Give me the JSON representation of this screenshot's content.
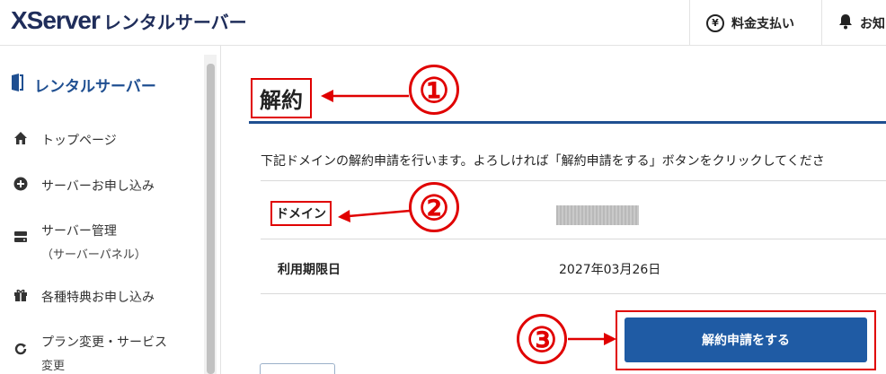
{
  "header": {
    "brand": "XServer",
    "product": "レンタルサーバー",
    "payment_label": "料金支払い",
    "notice_label": "お知"
  },
  "sidebar": {
    "title": "レンタルサーバー",
    "items": [
      {
        "label": "トップページ",
        "icon": "home-icon"
      },
      {
        "label": "サーバーお申し込み",
        "icon": "plus-circle-icon"
      },
      {
        "label": "サーバー管理",
        "sub": "（サーバーパネル）",
        "icon": "server-icon"
      },
      {
        "label": "各種特典お申し込み",
        "icon": "gift-icon"
      },
      {
        "label": "プラン変更・サービス",
        "sub": "変更",
        "icon": "refresh-icon"
      }
    ]
  },
  "main": {
    "title": "解約",
    "description": "下記ドメインの解約申請を行います。よろしければ「解約申請をする」ボタンをクリックしてくださ",
    "domain_label": "ドメイン",
    "expire_label": "利用期限日",
    "expire_value": "2027年03月26日",
    "cancel_button": "解約申請をする"
  },
  "annotations": {
    "one": "①",
    "two": "②",
    "three": "③"
  },
  "colors": {
    "accent": "#1f5ba4",
    "annotation": "#e00000",
    "brand": "#1f2d5a"
  }
}
